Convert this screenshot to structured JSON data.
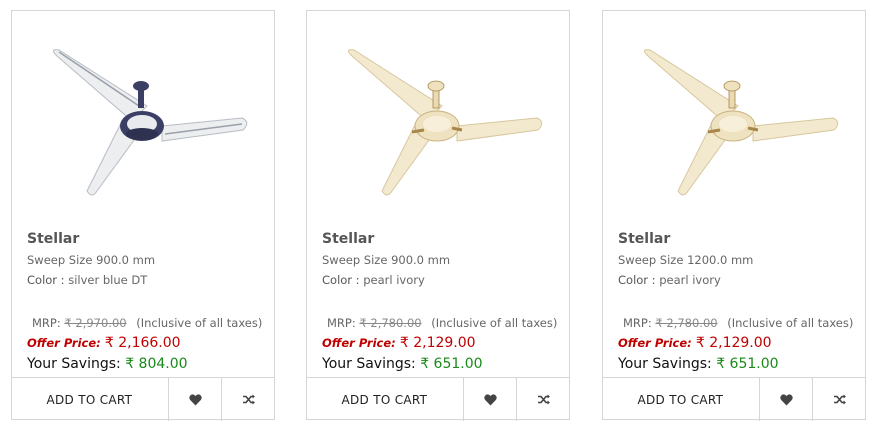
{
  "products": [
    {
      "brand": "Stellar",
      "sweep": "Sweep Size 900.0 mm",
      "color_label": "Color :",
      "color_value": "silver blue DT",
      "mrp_label": "MRP:",
      "mrp_value": "₹ 2,970.00",
      "tax_note": "(Inclusive of all taxes)",
      "offer_label": "Offer Price:",
      "offer_value": "₹ 2,166.00",
      "savings_label": "Your Savings:",
      "savings_value": "₹ 804.00",
      "cart_label": "ADD TO CART",
      "fan_variant": "silver-blue"
    },
    {
      "brand": "Stellar",
      "sweep": "Sweep Size 900.0 mm",
      "color_label": "Color :",
      "color_value": "pearl ivory",
      "mrp_label": "MRP:",
      "mrp_value": "₹ 2,780.00",
      "tax_note": "(Inclusive of all taxes)",
      "offer_label": "Offer Price:",
      "offer_value": "₹ 2,129.00",
      "savings_label": "Your Savings:",
      "savings_value": "₹ 651.00",
      "cart_label": "ADD TO CART",
      "fan_variant": "pearl-ivory"
    },
    {
      "brand": "Stellar",
      "sweep": "Sweep Size 1200.0 mm",
      "color_label": "Color :",
      "color_value": "pearl ivory",
      "mrp_label": "MRP:",
      "mrp_value": "₹ 2,780.00",
      "tax_note": "(Inclusive of all taxes)",
      "offer_label": "Offer Price:",
      "offer_value": "₹ 2,129.00",
      "savings_label": "Your Savings:",
      "savings_value": "₹ 651.00",
      "cart_label": "ADD TO CART",
      "fan_variant": "pearl-ivory"
    }
  ],
  "icons": {
    "wishlist": "heart-icon",
    "compare": "shuffle-icon"
  },
  "colors": {
    "offer_red": "#c00000",
    "savings_green": "#1a8a1a",
    "border": "#d6d6d6",
    "silver_blade": "#e9eaec",
    "navy_hub": "#3b3f63",
    "ivory_blade": "#f1e6c8",
    "gold_trim": "#a7864a"
  }
}
